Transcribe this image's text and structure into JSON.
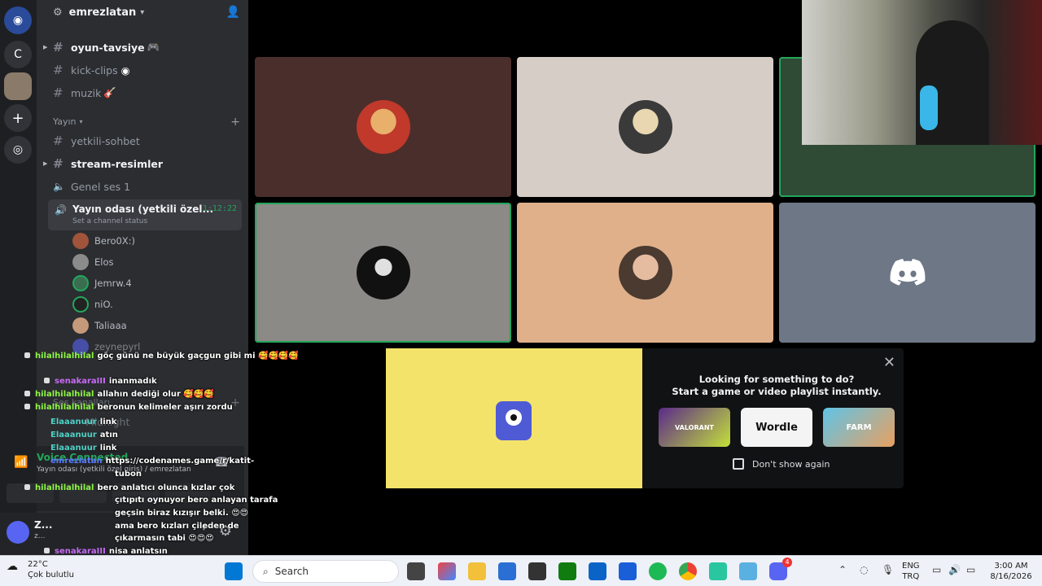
{
  "server": {
    "name": "emrezlatan"
  },
  "channels": [
    {
      "name": "oyun-tavsiye",
      "emoji": "🎮"
    },
    {
      "name": "kick-clips",
      "emoji": ""
    },
    {
      "name": "muzik",
      "emoji": "🎸"
    }
  ],
  "category_yayin": "Yayın",
  "yayin_channels": [
    "yetkili-sohbet",
    "stream-resimler",
    "Genel ses 1"
  ],
  "active_voice": {
    "name": "Yayın odası (yetkili özel...",
    "time": "1:12:22",
    "status": "Set a channel status"
  },
  "members": [
    "Bero0X:)",
    "Elos",
    "Jemrw.4",
    "niO.",
    "Taliaaa",
    "zeynepyrl"
  ],
  "category_ses": "Ses kanalları",
  "hidden_channel": "Midnight",
  "chat": [
    {
      "nick": "hilalhilalhilal",
      "text": "göç günü ne büyük gaçgun gibi mi 🥰🥰🥰🥰",
      "color": "#8ef542"
    },
    {
      "nick": "senakaraIII",
      "text": "inanmadık",
      "color": "#c86bf5"
    },
    {
      "nick": "hilalhilalhilal",
      "text": "allahın dediği olur 🥰🥰🥰",
      "color": "#8ef542"
    },
    {
      "nick": "hilalhilalhilal",
      "text": "beronun kelimeler aşırı zordu",
      "color": "#8ef542"
    },
    {
      "nick": "Elaaanuur",
      "text": "link",
      "color": "#4fd1c5"
    },
    {
      "nick": "Elaaanuur",
      "text": "atın",
      "color": "#4fd1c5"
    },
    {
      "nick": "Elaaanuur",
      "text": "link",
      "color": "#4fd1c5"
    },
    {
      "nick": "emrezlatan",
      "text": "https://codenames.game/r/katit-",
      "color": "#5b7cff"
    },
    {
      "nick": "",
      "text": "tubon",
      "color": "#ffffff"
    },
    {
      "nick": "hilalhilalhilal",
      "text": "bero anlatıcı olunca kızlar çok",
      "color": "#8ef542"
    },
    {
      "nick": "",
      "text": "çıtıpıtı oynuyor bero anlayan tarafa",
      "color": "#ffffff"
    },
    {
      "nick": "",
      "text": "geçsin biraz kızışır belki. 😍😍",
      "color": "#ffffff"
    },
    {
      "nick": "",
      "text": "ama bero kızları çileden de",
      "color": "#ffffff"
    },
    {
      "nick": "",
      "text": "çıkarmasın tabi 😍😍😍",
      "color": "#ffffff"
    },
    {
      "nick": "senakaraIII",
      "text": "nisa anlatsın",
      "color": "#c86bf5"
    }
  ],
  "voice_connected": {
    "title": "Voice Connected",
    "sub": "Yayın odası (yetkili özel giriş) / emrezlatan"
  },
  "user": {
    "name": "Z...",
    "status": "z..."
  },
  "activity": {
    "line1": "Looking for something to do?",
    "line2": "Start a game or video playlist instantly.",
    "games": [
      "VALORANT",
      "Wordle",
      "FARM"
    ],
    "dont_show": "Don't show again"
  },
  "taskbar": {
    "temp": "22°C",
    "weather": "Çok bulutlu",
    "search": "Search",
    "lang1": "ENG",
    "lang2": "TRQ",
    "time": "3:00 AM",
    "date": "8/16/2026",
    "discord_badge": "4"
  },
  "colors": {
    "accent_green": "#23a55a",
    "tile1": "#4a2e2b",
    "tile2": "#d6cdc6",
    "tile3": "#2f4a35",
    "tile4": "#8b8a86",
    "tile5": "#dfb08a",
    "tile6": "#6d7785"
  }
}
